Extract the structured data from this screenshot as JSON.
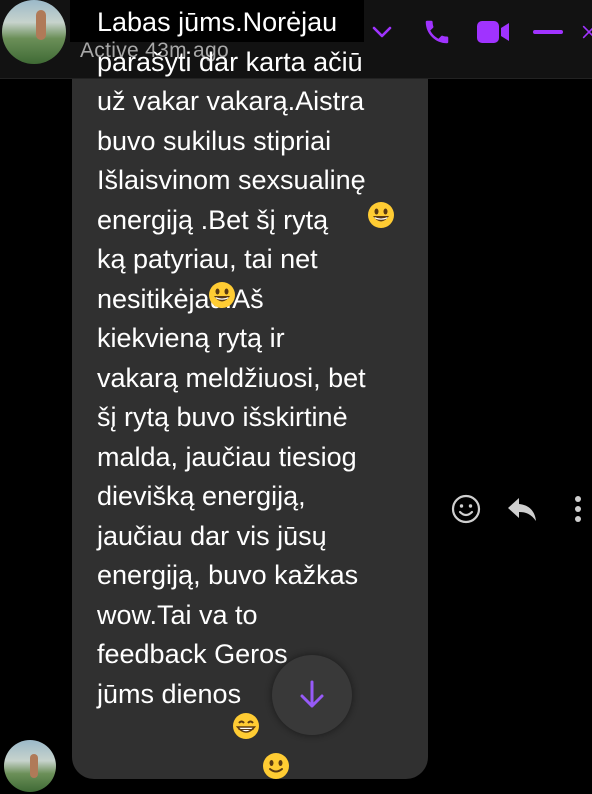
{
  "header": {
    "status": "Active 43m ago",
    "icons": [
      "chevron-down-icon",
      "phone-icon",
      "video-icon",
      "minimize-icon",
      "close-icon"
    ],
    "accent_color": "#a033ff"
  },
  "message": {
    "text": "Labas jūms.Norėjau\nparašyti dar karta ačiū\nuž vakar vakarą.Aistra\nbuvo sukilus stipriai\nIšlaisvinom sexsualinę\nenergiją  .Bet šį rytą\nką patyriau, tai net\nnesitikėjau.Aš\nkiekvieną rytą ir\nvakarą meldžiuosi, bet\nšį rytą buvo išskirtinė\nmalda, jaučiau tiesiog\ndievišką energiją,\njaučiau dar vis jūsų\nenergiją, buvo kažkas\nwow.Tai va to\nfeedback     Geros\njūms dienos",
    "emojis": [
      "grinning-face",
      "grinning-face",
      "beaming-face",
      "slightly-smiling-face"
    ]
  },
  "actions": {
    "icons": [
      "react-emoji-icon",
      "reply-icon",
      "more-options-icon",
      "scroll-down-arrow-icon"
    ]
  }
}
